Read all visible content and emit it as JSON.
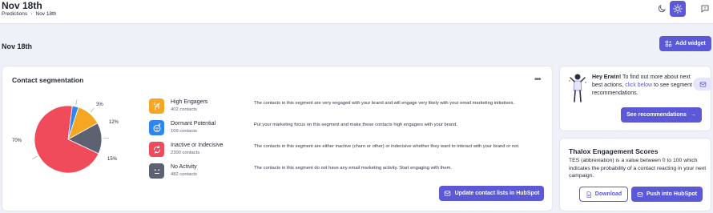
{
  "header": {
    "title": "Nov 18th",
    "breadcrumbs": [
      "Predictions",
      "Nov 18th"
    ],
    "theme_dark_icon": "moon-icon",
    "theme_light_icon": "sun-icon",
    "feedback_icon": "feedback-icon"
  },
  "section": {
    "title": "Nov 18th",
    "add_widget_label": "Add widget"
  },
  "segmentation": {
    "title": "Contact segmentation",
    "update_button": "Update contact lists in HubSpot",
    "segments": [
      {
        "name": "High Engagers",
        "count": "402 contacts",
        "color": "#f5a623",
        "icon": "sparkle-hand-icon",
        "description": "The contacts in this segment are very engaged with your brand and will engage very likely with your email marketing initiatives."
      },
      {
        "name": "Dormant Potential",
        "count": "109 contacts",
        "color": "#2e86f0",
        "icon": "sleeping-face-icon",
        "description": "Put your marketing focus on this segment and make these contacts high engagers with your brand."
      },
      {
        "name": "Inactive or Indecisive",
        "count": "2300 contacts",
        "color": "#f04b5a",
        "icon": "cycle-icon",
        "description": "The contacts in this segment are either inactive (churn or other) or indecisive whether they want to interact with your brand or not."
      },
      {
        "name": "No Activity",
        "count": "482 contacts",
        "color": "#5c6272",
        "icon": "neutral-face-icon",
        "description": "The contacts in this segment do not have any email marketing activity. Start engaging with them."
      }
    ]
  },
  "chart_data": {
    "type": "pie",
    "labels": [
      "High Engagers",
      "Dormant Potential",
      "Inactive or Indecisive",
      "No Activity"
    ],
    "values": [
      12,
      3,
      70,
      15
    ],
    "value_labels": [
      "12%",
      "3%",
      "70%",
      "15%"
    ],
    "colors": [
      "#f5a623",
      "#2e86f0",
      "#f04b5a",
      "#5c6272"
    ]
  },
  "recommendations": {
    "greeting": "Hey Erwin!",
    "text_before_link": " To find out more about next best actions, ",
    "link": "click below",
    "text_after_link": " to see segment recommendations.",
    "button": "See recommendations",
    "arrow": "→"
  },
  "tes": {
    "title": "Thalox Engagement Scores",
    "description": "TES (abbreviation) is a value between 0 to 100 which indicates the probability of a contact reacting in your next campaign.",
    "download_label": "Download",
    "push_label": "Push into HubSpot"
  }
}
